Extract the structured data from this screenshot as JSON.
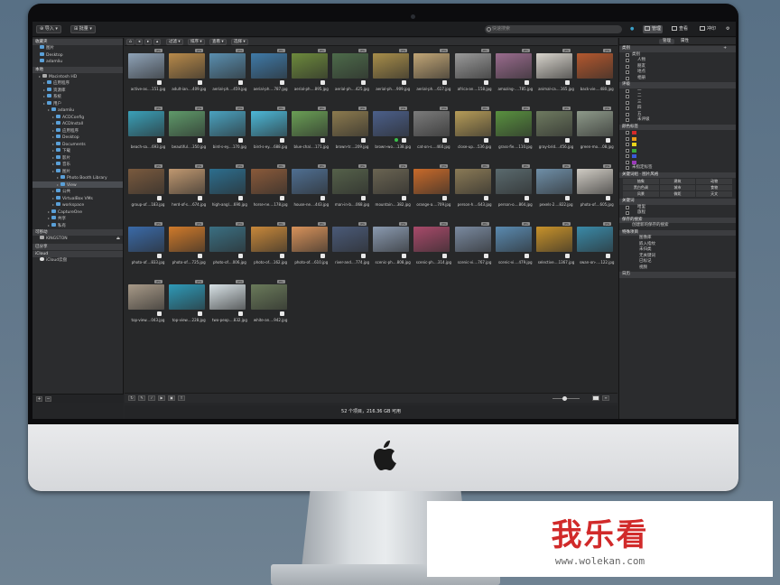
{
  "topbar": {
    "import_label": "导入",
    "batch_label": "批量",
    "search_placeholder": "快速搜索",
    "modes": [
      {
        "label": "管理",
        "active": true
      },
      {
        "label": "查看",
        "active": false
      },
      {
        "label": "冲印",
        "active": false
      }
    ]
  },
  "left_panel": {
    "favorites": {
      "header": "收藏夹",
      "items": [
        "图片",
        "Desktop",
        "adamliu"
      ]
    },
    "local": {
      "header": "本地",
      "items": [
        {
          "label": "Macintosh HD",
          "indent": 1,
          "icon": "disk"
        },
        {
          "label": "应用程序",
          "indent": 2
        },
        {
          "label": "资源库",
          "indent": 2
        },
        {
          "label": "系统",
          "indent": 2
        },
        {
          "label": "用户",
          "indent": 2
        },
        {
          "label": "adamliu",
          "indent": 3
        },
        {
          "label": "ACDConfig",
          "indent": 4
        },
        {
          "label": "ACDInstall",
          "indent": 4
        },
        {
          "label": "应用程序",
          "indent": 4
        },
        {
          "label": "Desktop",
          "indent": 4
        },
        {
          "label": "Documents",
          "indent": 4
        },
        {
          "label": "下载",
          "indent": 4
        },
        {
          "label": "影片",
          "indent": 4
        },
        {
          "label": "音乐",
          "indent": 4
        },
        {
          "label": "图片",
          "indent": 4
        },
        {
          "label": "Photo Booth Library",
          "indent": 5
        },
        {
          "label": "View",
          "indent": 5,
          "selected": true
        },
        {
          "label": "公共",
          "indent": 4
        },
        {
          "label": "VirtualBox VMs",
          "indent": 4
        },
        {
          "label": "workspace",
          "indent": 4
        },
        {
          "label": "CaptureOne",
          "indent": 3
        },
        {
          "label": "共享",
          "indent": 3
        },
        {
          "label": "私有",
          "indent": 3
        }
      ]
    },
    "removable": {
      "header": "可移动",
      "items": [
        "KINGSTON"
      ]
    },
    "shared": {
      "header": "已分享"
    },
    "icloud": {
      "header": "iCloud",
      "items": [
        "iCloud云盘"
      ]
    }
  },
  "main_toolbar": {
    "filter": "过滤",
    "sort": "排序",
    "view": "查看",
    "select": "选择"
  },
  "thumbnails": [
    {
      "name": "active-as....151.jpg",
      "color": "#8fa3b8"
    },
    {
      "name": "adult-ian....409.jpg",
      "color": "#b88a4a"
    },
    {
      "name": "aerial-ph....459.jpg",
      "color": "#5a8fb0"
    },
    {
      "name": "aerial-ph....787.jpg",
      "color": "#3f7aa8"
    },
    {
      "name": "aerial-ph....895.jpg",
      "color": "#6d8a3c"
    },
    {
      "name": "aerial-ph....425.jpg",
      "color": "#4d6b4a"
    },
    {
      "name": "aerial-ph....909.jpg",
      "color": "#a88e4a"
    },
    {
      "name": "aerial-ph....617.jpg",
      "color": "#c2a676"
    },
    {
      "name": "africa-an....158.jpg",
      "color": "#9a9a9a"
    },
    {
      "name": "amazing-....785.jpg",
      "color": "#9a6c8e"
    },
    {
      "name": "animal-ca....165.jpg",
      "color": "#d8d4cc"
    },
    {
      "name": "back-vie....480.jpg",
      "color": "#b4582e"
    },
    {
      "name": "beach-sa....693.jpg",
      "color": "#3aa0b8"
    },
    {
      "name": "beautiful....350.jpg",
      "color": "#5f9a6a"
    },
    {
      "name": "bird-s-ey....170.jpg",
      "color": "#4aa2c0"
    },
    {
      "name": "bird-s-ey....688.jpg",
      "color": "#4cb8d8"
    },
    {
      "name": "blue-chal....171.jpg",
      "color": "#6a9f55"
    },
    {
      "name": "brown-tr....209.jpg",
      "color": "#8c7a4e"
    },
    {
      "name": "brown-wo....138.jpg",
      "color": "#4b5f8a",
      "dot": true
    },
    {
      "name": "cat-on-s....460.jpg",
      "color": "#7b7b7b"
    },
    {
      "name": "close-up....536.jpg",
      "color": "#b69c58"
    },
    {
      "name": "grass-fie....110.jpg",
      "color": "#59913f"
    },
    {
      "name": "gray-brid....456.jpg",
      "color": "#6e7a60"
    },
    {
      "name": "green-mo....08.jpg",
      "color": "#8e9a8a"
    },
    {
      "name": "group-of....183.jpg",
      "color": "#7a5a3e"
    },
    {
      "name": "herd-of-s....674.jpg",
      "color": "#c09870"
    },
    {
      "name": "high-angl....690.jpg",
      "color": "#2c6e8e"
    },
    {
      "name": "horse-ne....178.jpg",
      "color": "#8a5a3a"
    },
    {
      "name": "house-ne....443.jpg",
      "color": "#4f6f92"
    },
    {
      "name": "man-in-b....068.jpg",
      "color": "#55614a"
    },
    {
      "name": "mountain....382.jpg",
      "color": "#6a6452"
    },
    {
      "name": "orange-a....709.jpg",
      "color": "#c86a2a"
    },
    {
      "name": "person-h....643.jpg",
      "color": "#8a7a56"
    },
    {
      "name": "person-o....864.jpg",
      "color": "#5a6a6e"
    },
    {
      "name": "pexels-2....822.jpg",
      "color": "#6f8fa8"
    },
    {
      "name": "photo-of....605.jpg",
      "color": "#d0ccc4"
    },
    {
      "name": "photo-of....833.jpg",
      "color": "#3a6aa8"
    },
    {
      "name": "photo-of....725.jpg",
      "color": "#d07a2a"
    },
    {
      "name": "photo-of....006.jpg",
      "color": "#3a6f82"
    },
    {
      "name": "photo-of....162.jpg",
      "color": "#c8883a"
    },
    {
      "name": "photo-of....610.jpg",
      "color": "#d8925a"
    },
    {
      "name": "river-and....774.jpg",
      "color": "#4a5a78"
    },
    {
      "name": "scenic-ph....808.jpg",
      "color": "#8a9ab0"
    },
    {
      "name": "scenic-ph....314.jpg",
      "color": "#a84a6a"
    },
    {
      "name": "scenic-vi....767.jpg",
      "color": "#7a8aa0"
    },
    {
      "name": "scenic-vi....479.jpg",
      "color": "#5a8ab0"
    },
    {
      "name": "selective....1367.jpg",
      "color": "#c8922a"
    },
    {
      "name": "swan-on-....122.jpg",
      "color": "#3a8aa8"
    },
    {
      "name": "top-view....043.jpg",
      "color": "#a89a88"
    },
    {
      "name": "top-view....228.jpg",
      "color": "#2e9ab8"
    },
    {
      "name": "two-peop....832.jpg",
      "color": "#d8e2e6"
    },
    {
      "name": "white-an....942.jpg",
      "color": "#6a7a5a"
    }
  ],
  "status": "52 个项目，216.36 GB 可用",
  "right_panel": {
    "tabs": [
      "管理",
      "属性"
    ],
    "categories_header": "类别",
    "categories_sub": "类别",
    "categories": [
      "人物",
      "朋友",
      "地点",
      "相册"
    ],
    "rating_header": "评级",
    "ratings": [
      "一",
      "二",
      "三",
      "四",
      "五",
      "未评级"
    ],
    "color_header": "颜色标签",
    "colors": [
      "#d42a2a",
      "#e89a1a",
      "#e8d41a",
      "#3aa83a",
      "#3a5ad8",
      "#9a3ab8"
    ],
    "color_last": "未指定标签",
    "keyword_header": "关键词组 · 图片风格",
    "keyword_cells": [
      "抽象",
      "建筑",
      "动物",
      "黑白色调",
      "城市",
      "食物",
      "风景",
      "微距",
      "天文"
    ],
    "keywords_header": "关键词",
    "keywords": [
      "哈里",
      "旅程"
    ],
    "saved_header": "保存的搜索",
    "saved_item": "创建新的保存的搜索",
    "special_header": "特殊项目",
    "special_items": [
      "图像库",
      "嵌入指纹",
      "未归类",
      "无关键词",
      "已标记",
      "视频"
    ],
    "calendar_header": "日历"
  },
  "watermark": {
    "title": "我乐看",
    "url": "www.wolekan.com"
  }
}
